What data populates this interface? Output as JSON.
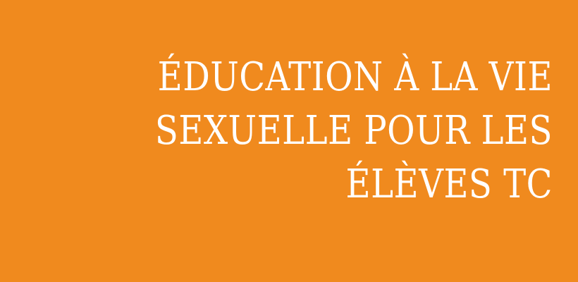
{
  "banner": {
    "background_color": "#F08A1E",
    "text_color": "#FFFFFF",
    "title_lines": [
      "ÉDUCATION À LA VIE",
      "SEXUELLE POUR LES",
      "ÉLÈVES TC"
    ]
  }
}
